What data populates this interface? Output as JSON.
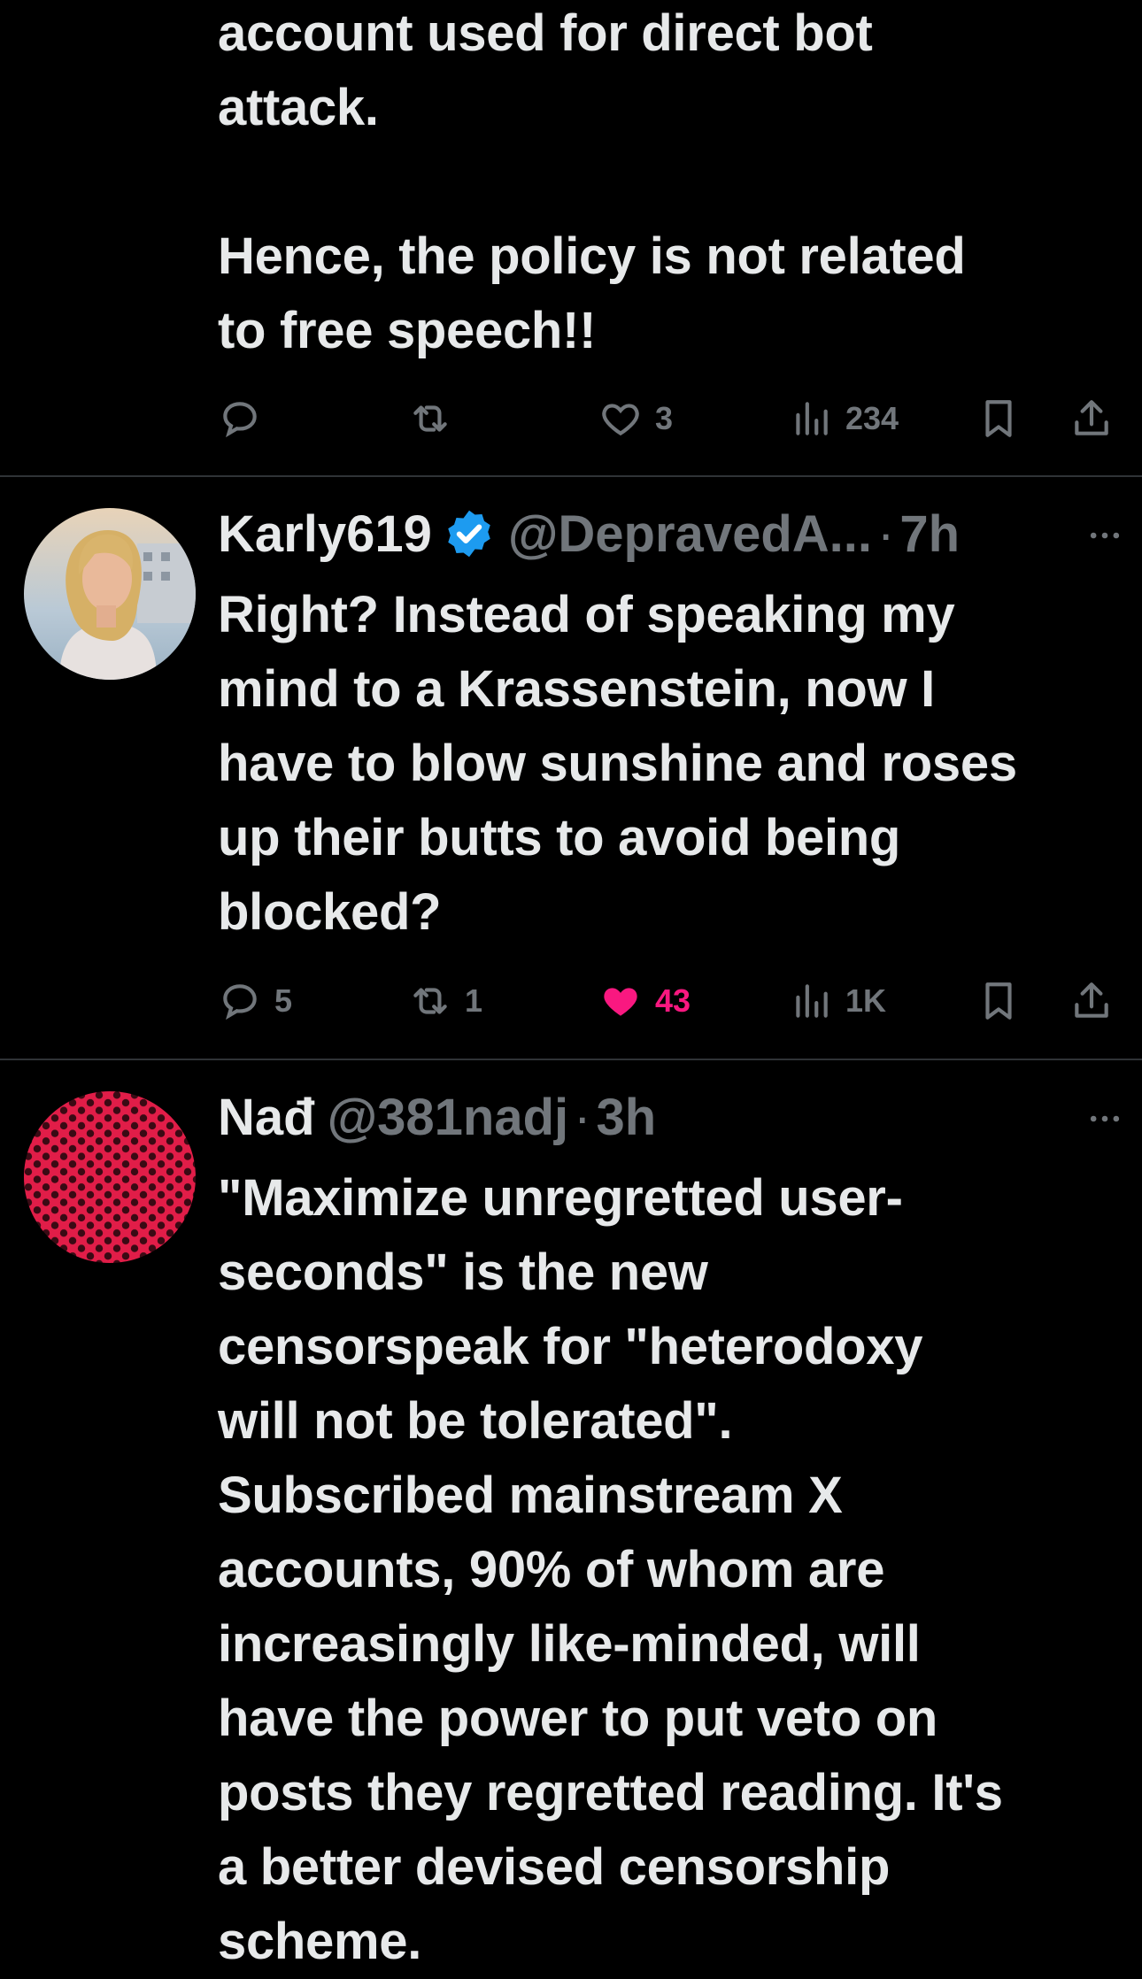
{
  "tweets": [
    {
      "text": "account used for direct bot\nattack.\n\nHence, the policy is not related\nto free speech!!",
      "actions": {
        "reply": "",
        "retweet": "",
        "like": "3",
        "views": "234"
      }
    },
    {
      "name": "Karly619",
      "handle": "@DepravedA...",
      "dot": "·",
      "time": "7h",
      "text": "Right? Instead of speaking my\nmind to a Krassenstein, now I\nhave to blow sunshine and roses\nup their butts to avoid being\nblocked?",
      "actions": {
        "reply": "5",
        "retweet": "1",
        "like": "43",
        "views": "1K"
      }
    },
    {
      "name": "Nađ",
      "handle": "@381nadj",
      "dot": "·",
      "time": "3h",
      "text": "\"Maximize unregretted user-\nseconds\" is the new\ncensorspeak for \"heterodoxy\nwill not be tolerated\".\nSubscribed mainstream X\naccounts, 90% of whom are\nincreasingly like-minded, will\nhave the power to put veto on\nposts they regretted reading. It's\na better devised censorship\nscheme."
    }
  ],
  "icons": {
    "reply": "reply-icon",
    "retweet": "retweet-icon",
    "like": "heart-icon",
    "liked": "heart-filled-icon",
    "views": "views-icon",
    "bookmark": "bookmark-icon",
    "share": "share-icon",
    "more": "more-icon",
    "verified": "verified-badge-icon"
  },
  "colors": {
    "background": "#000000",
    "text": "#e7e9ea",
    "muted": "#71767b",
    "like": "#f91880",
    "verified": "#1d9bf0",
    "divider": "#2f3336"
  }
}
